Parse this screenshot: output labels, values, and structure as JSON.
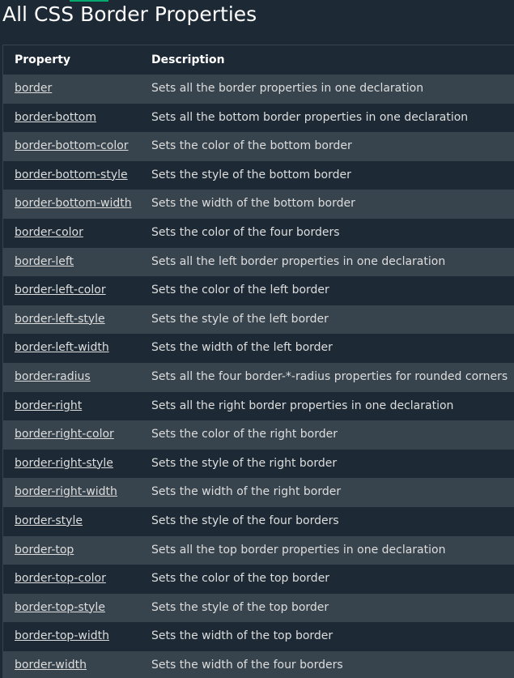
{
  "page": {
    "title": "All CSS Border Properties"
  },
  "table": {
    "headers": {
      "property": "Property",
      "description": "Description"
    },
    "rows": [
      {
        "property": "border",
        "description": "Sets all the border properties in one declaration"
      },
      {
        "property": "border-bottom",
        "description": "Sets all the bottom border properties in one declaration"
      },
      {
        "property": "border-bottom-color",
        "description": "Sets the color of the bottom border"
      },
      {
        "property": "border-bottom-style",
        "description": "Sets the style of the bottom border"
      },
      {
        "property": "border-bottom-width",
        "description": "Sets the width of the bottom border"
      },
      {
        "property": "border-color",
        "description": "Sets the color of the four borders"
      },
      {
        "property": "border-left",
        "description": "Sets all the left border properties in one declaration"
      },
      {
        "property": "border-left-color",
        "description": "Sets the color of the left border"
      },
      {
        "property": "border-left-style",
        "description": "Sets the style of the left border"
      },
      {
        "property": "border-left-width",
        "description": "Sets the width of the left border"
      },
      {
        "property": "border-radius",
        "description": "Sets all the four border-*-radius properties for rounded corners"
      },
      {
        "property": "border-right",
        "description": "Sets all the right border properties in one declaration"
      },
      {
        "property": "border-right-color",
        "description": "Sets the color of the right border"
      },
      {
        "property": "border-right-style",
        "description": "Sets the style of the right border"
      },
      {
        "property": "border-right-width",
        "description": "Sets the width of the right border"
      },
      {
        "property": "border-style",
        "description": "Sets the style of the four borders"
      },
      {
        "property": "border-top",
        "description": "Sets all the top border properties in one declaration"
      },
      {
        "property": "border-top-color",
        "description": "Sets the color of the top border"
      },
      {
        "property": "border-top-style",
        "description": "Sets the style of the top border"
      },
      {
        "property": "border-top-width",
        "description": "Sets the width of the top border"
      },
      {
        "property": "border-width",
        "description": "Sets the width of the four borders"
      }
    ]
  },
  "colors": {
    "background": "#1d2a35",
    "row_alt": "#38444d",
    "accent": "#04aa6d",
    "text": "#dddddd"
  }
}
